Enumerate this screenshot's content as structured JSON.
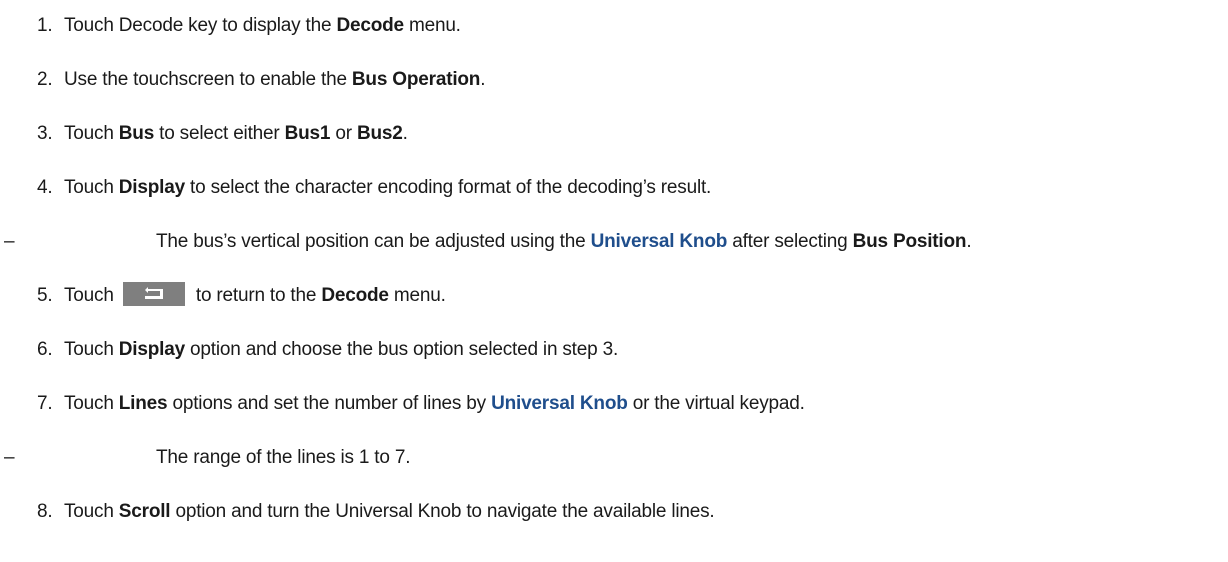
{
  "steps": [
    {
      "n": "1.",
      "a": "Touch Decode key to display the ",
      "b": "Decode",
      "c": " menu."
    },
    {
      "n": "2.",
      "a": "Use the touchscreen to enable the ",
      "b": "Bus Operation",
      "c": "."
    },
    {
      "n": "3.",
      "a": "Touch ",
      "b": "Bus",
      "c": " to select either ",
      "d": "Bus1",
      "e": " or ",
      "f": "Bus2",
      "g": "."
    },
    {
      "n": "4.",
      "a": "Touch ",
      "b": "Display",
      "c": " to select the character encoding format of the decoding’s result."
    },
    {
      "n": "5.",
      "a": "Touch ",
      "c": " to return to the ",
      "d": "Decode",
      "e": " menu."
    },
    {
      "n": "6.",
      "a": "Touch ",
      "b": "Display",
      "c": " option and choose the bus option selected in step 3."
    },
    {
      "n": "7.",
      "a": "Touch ",
      "b": "Lines",
      "c": " options and set the number of lines by ",
      "d": "Universal Knob",
      "e": " or the virtual keypad."
    },
    {
      "n": "8.",
      "a": "Touch ",
      "b": "Scroll",
      "c": " option and turn the Universal Knob to navigate the available lines."
    }
  ],
  "notes": [
    {
      "dash": "–",
      "a": "The bus’s vertical position can be adjusted using the ",
      "b": "Universal Knob",
      "c": " after selecting ",
      "d": "Bus Position",
      "e": "."
    },
    {
      "dash": "–",
      "a": "The range of the lines is 1 to 7."
    }
  ],
  "icons": {
    "return_button": "return-arrow-icon"
  },
  "colors": {
    "link": "#1f4e8c",
    "button": "#7f7f7f"
  }
}
